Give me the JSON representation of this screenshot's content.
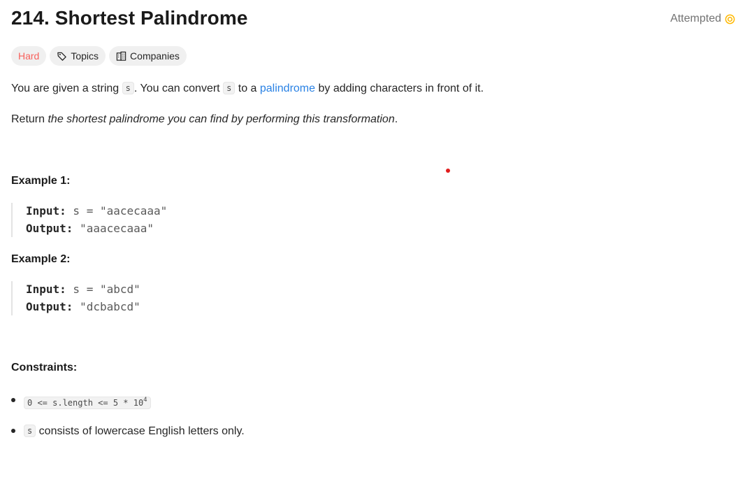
{
  "problem": {
    "title": "214. Shortest Palindrome",
    "status": "Attempted",
    "status_color": "#ffb800"
  },
  "badges": {
    "difficulty": "Hard",
    "difficulty_color": "#f8615c",
    "topics": "Topics",
    "companies": "Companies"
  },
  "description": {
    "p1_part1": "You are given a string ",
    "p1_code1": "s",
    "p1_part2": ". You can convert ",
    "p1_code2": "s",
    "p1_part3": " to a ",
    "p1_link": "palindrome",
    "p1_part4": " by adding characters in front of it.",
    "p2_part1": "Return ",
    "p2_em": "the shortest palindrome you can find by performing this transformation",
    "p2_part2": "."
  },
  "examples": [
    {
      "title": "Example 1:",
      "input_label": "Input:",
      "input_value": " s = \"aacecaaa\"",
      "output_label": "Output:",
      "output_value": " \"aaacecaaa\""
    },
    {
      "title": "Example 2:",
      "input_label": "Input:",
      "input_value": " s = \"abcd\"",
      "output_label": "Output:",
      "output_value": " \"dcbabcd\""
    }
  ],
  "constraints": {
    "title": "Constraints:",
    "c1_code": "0 <= s.length <= 5 * 10",
    "c1_sup": "4",
    "c2_code": "s",
    "c2_text": " consists of lowercase English letters only."
  }
}
